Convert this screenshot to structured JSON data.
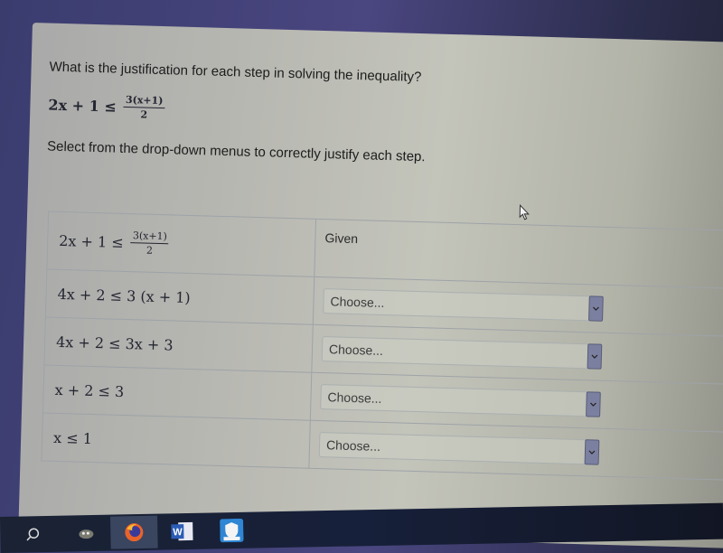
{
  "question": {
    "title": "What is the justification for each step in solving the inequality?",
    "inequality": {
      "lhs": "2x + 1 ≤",
      "num": "3(x+1)",
      "den": "2"
    },
    "instructions": "Select from the drop-down menus to correctly justify each step."
  },
  "steps": [
    {
      "expr": "2x + 1 ≤",
      "num": "3(x+1)",
      "den": "2",
      "justification": "Given"
    },
    {
      "expr": "4x + 2 ≤ 3 (x + 1)",
      "dropdown": "Choose..."
    },
    {
      "expr": "4x + 2 ≤ 3x + 3",
      "dropdown": "Choose..."
    },
    {
      "expr": "x + 2 ≤ 3",
      "dropdown": "Choose..."
    },
    {
      "expr": "x ≤ 1",
      "dropdown": "Choose..."
    }
  ],
  "taskbar": {
    "items": [
      "search-icon",
      "gimp-icon",
      "firefox-icon",
      "word-icon",
      "shield-app-icon"
    ]
  }
}
